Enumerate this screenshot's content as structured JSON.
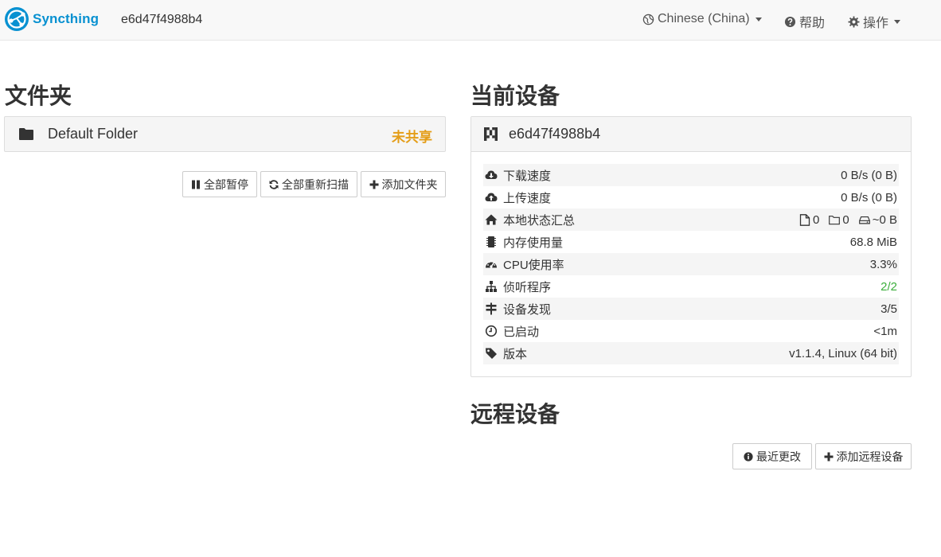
{
  "navbar": {
    "brand": "Syncthing",
    "device_id": "e6d47f4988b4",
    "language": "Chinese (China)",
    "help": "帮助",
    "actions": "操作"
  },
  "folders": {
    "heading": "文件夹",
    "items": [
      {
        "name": "Default Folder",
        "status": "未共享"
      }
    ],
    "buttons": {
      "pause_all": "全部暂停",
      "rescan_all": "全部重新扫描",
      "add_folder": "添加文件夹"
    }
  },
  "this_device": {
    "heading": "当前设备",
    "name": "e6d47f4988b4",
    "stats": [
      {
        "icon": "cloud-download-icon",
        "label": "下载速度",
        "value": "0 B/s (0 B)"
      },
      {
        "icon": "cloud-upload-icon",
        "label": "上传速度",
        "value": "0 B/s (0 B)"
      },
      {
        "icon": "home-icon",
        "label": "本地状态汇总",
        "files": "0",
        "dirs": "0",
        "size": "~0 B"
      },
      {
        "icon": "memory-icon",
        "label": "内存使用量",
        "value": "68.8 MiB"
      },
      {
        "icon": "dashboard-icon",
        "label": "CPU使用率",
        "value": "3.3%"
      },
      {
        "icon": "sitemap-icon",
        "label": "侦听程序",
        "value": "2/2"
      },
      {
        "icon": "signpost-icon",
        "label": "设备发现",
        "value": "3/5"
      },
      {
        "icon": "clock-icon",
        "label": "已启动",
        "value": "<1m"
      },
      {
        "icon": "tag-icon",
        "label": "版本",
        "value": "v1.1.4, Linux (64 bit)"
      }
    ]
  },
  "remote_devices": {
    "heading": "远程设备",
    "buttons": {
      "recent_changes": "最近更改",
      "add_remote_device": "添加远程设备"
    }
  },
  "colors": {
    "brand": "#0891d1",
    "unshared": "#e49d17",
    "success": "#3cae3c"
  }
}
